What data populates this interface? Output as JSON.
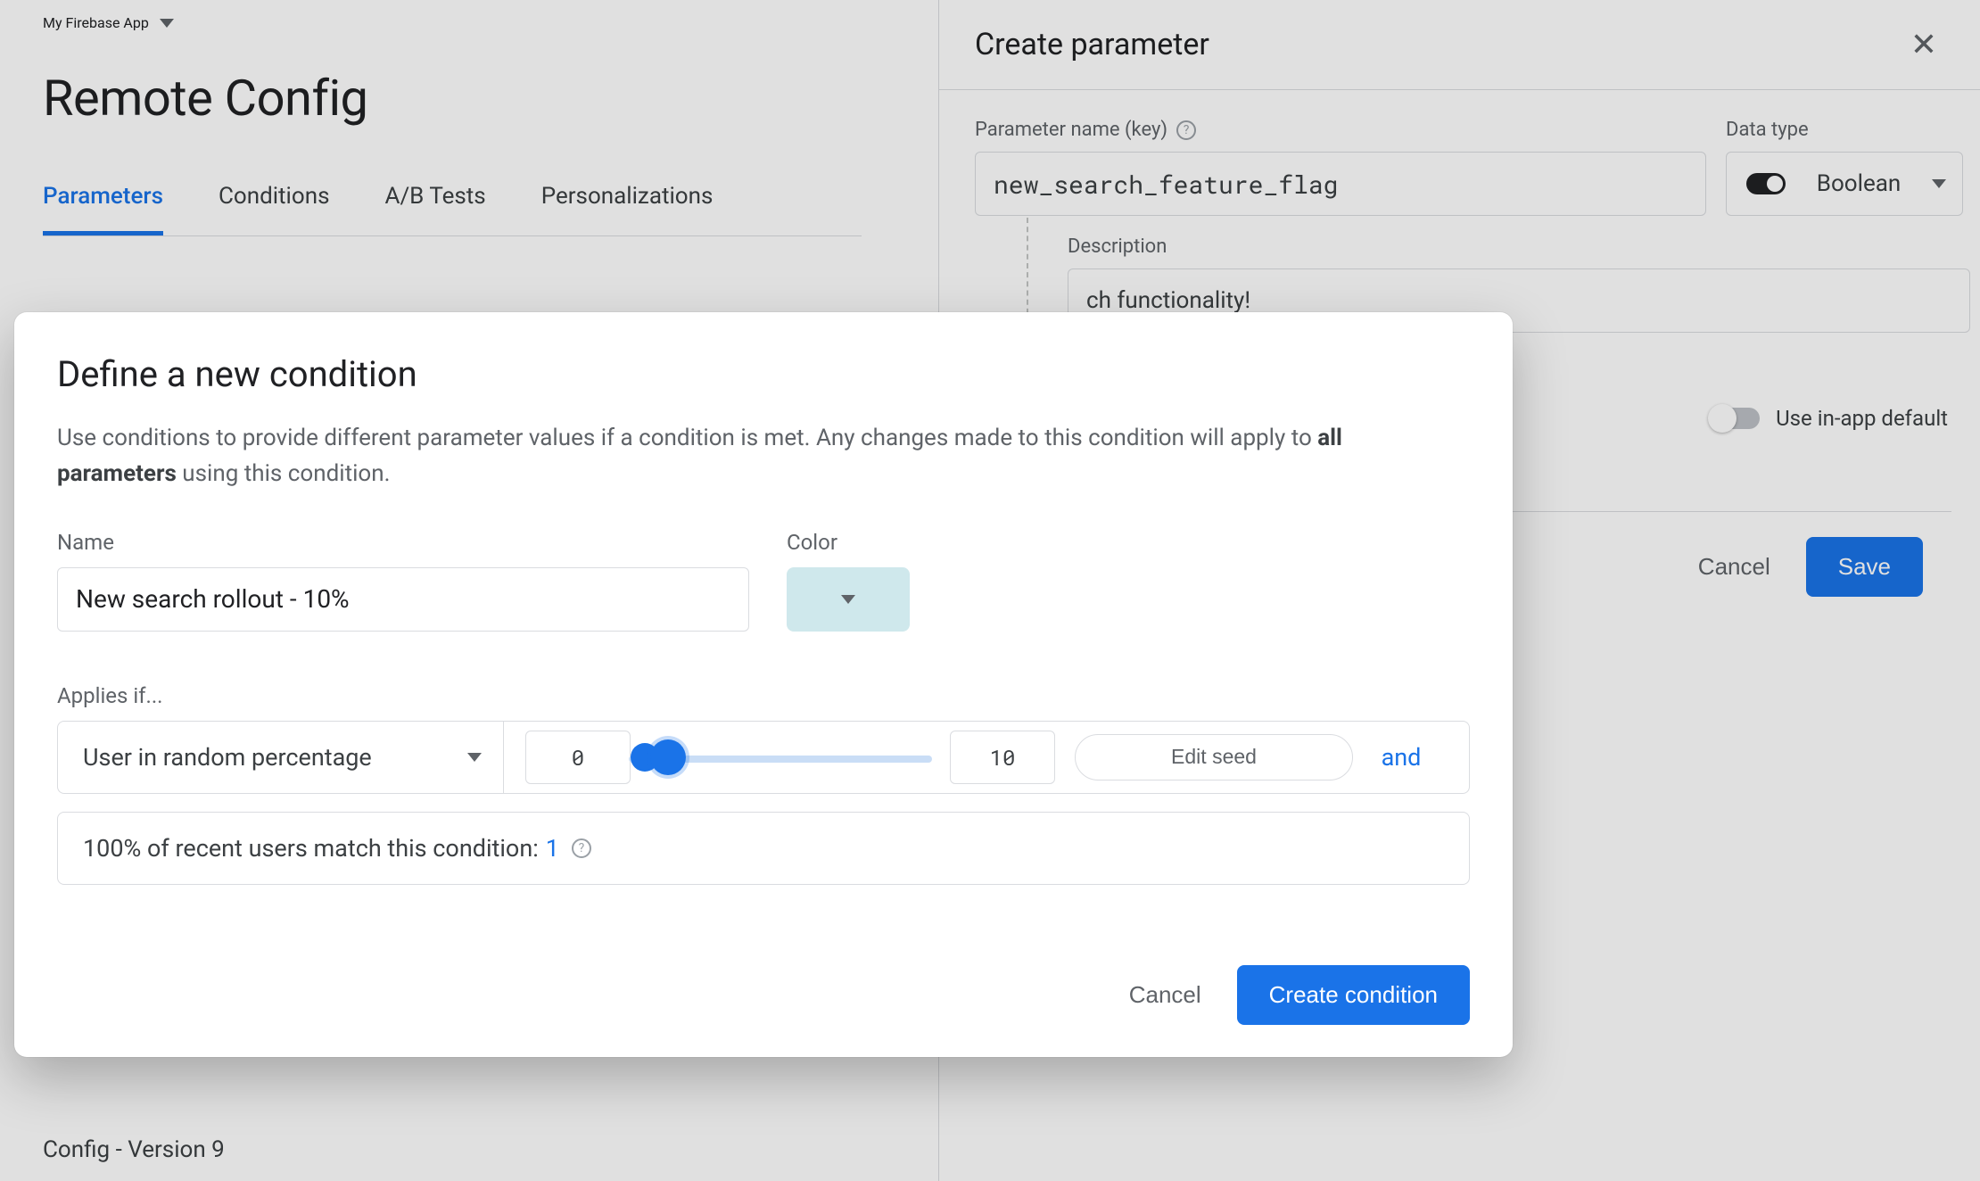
{
  "app": {
    "name": "My Firebase App"
  },
  "page": {
    "title": "Remote Config",
    "tabs": [
      "Parameters",
      "Conditions",
      "A/B Tests",
      "Personalizations"
    ],
    "activeTab": 0,
    "version": "Config - Version 9"
  },
  "panel": {
    "title": "Create parameter",
    "paramLabel": "Parameter name (key)",
    "paramValue": "new_search_feature_flag",
    "dataTypeLabel": "Data type",
    "dataTypeValue": "Boolean",
    "descriptionLabel": "Description",
    "descriptionFragment": "ch functionality!",
    "useInAppDefaultLabel": "Use in-app default",
    "cancel": "Cancel",
    "save": "Save"
  },
  "dialog": {
    "title": "Define a new condition",
    "subPrefix": "Use conditions to provide different parameter values if a condition is met. Any changes made to this condition will apply to ",
    "subBold": "all parameters",
    "subSuffix": " using this condition.",
    "nameLabel": "Name",
    "nameValue": "New search rollout - 10%",
    "colorLabel": "Color",
    "colorValue": "#cfe8ec",
    "appliesIfLabel": "Applies if...",
    "criterion": {
      "type": "User in random percentage",
      "from": "0",
      "to": "10",
      "editSeed": "Edit seed",
      "and": "and"
    },
    "matchPrefix": "100% of recent users match this condition: ",
    "matchCount": "1",
    "cancel": "Cancel",
    "create": "Create condition"
  }
}
